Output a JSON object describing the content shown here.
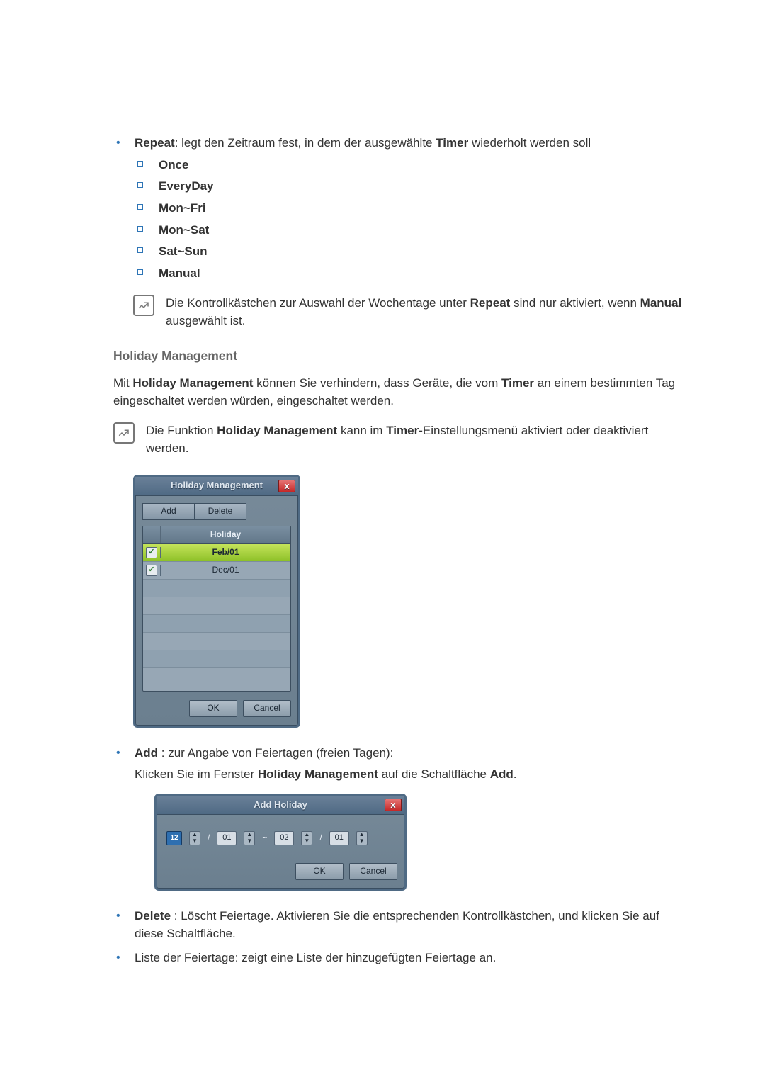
{
  "repeat": {
    "label": "Repeat",
    "desc_1": ": legt den Zeitraum fest, in dem der ausgewählte ",
    "desc_2": " wiederholt werden soll",
    "timer": "Timer",
    "options": {
      "once": "Once",
      "everyday": "EveryDay",
      "monfri": "Mon~Fri",
      "monsat": "Mon~Sat",
      "satsun": "Sat~Sun",
      "manual": "Manual"
    }
  },
  "note1": {
    "t1": "Die Kontrollkästchen zur Auswahl der Wochentage unter ",
    "t2": " sind nur aktiviert, wenn ",
    "t3": " ausgewählt ist.",
    "repeat": "Repeat",
    "manual": "Manual"
  },
  "hm": {
    "heading": "Holiday Management",
    "p1a": "Mit ",
    "p1b": " können Sie verhindern, dass Geräte, die vom ",
    "p1c": " an einem bestimmten Tag eingeschaltet werden würden, eingeschaltet werden.",
    "hm_b": "Holiday Management",
    "timer_b": "Timer"
  },
  "note2": {
    "t1": "Die Funktion ",
    "t2": " kann im ",
    "t3": "-Einstellungsmenü aktiviert oder deaktiviert werden.",
    "hm": "Holiday Management",
    "timer": "Timer"
  },
  "dlg1": {
    "title": "Holiday Management",
    "add": "Add",
    "delete": "Delete",
    "col": "Holiday",
    "rows": {
      "r1": "Feb/01",
      "r2": "Dec/01"
    },
    "ok": "OK",
    "cancel": "Cancel"
  },
  "add": {
    "label": "Add",
    "rest": " : zur Angabe von Feiertagen (freien Tagen):",
    "sub_a": "Klicken Sie im Fenster ",
    "sub_b": " auf die Schaltfläche ",
    "sub_c": ".",
    "hm": "Holiday Management",
    "add_b": "Add"
  },
  "dlg2": {
    "title": "Add Holiday",
    "cal": "12",
    "m1": "01",
    "d1": "01",
    "m2": "02",
    "d2": "01",
    "slash": "/",
    "tilde": "~",
    "ok": "OK",
    "cancel": "Cancel"
  },
  "del": {
    "label": "Delete",
    "rest": " : Löscht Feiertage. Aktivieren Sie die entsprechenden Kontrollkästchen, und klicken Sie auf diese Schaltfläche."
  },
  "list": {
    "text": "Liste der Feiertage: zeigt eine Liste der hinzugefügten Feiertage an."
  }
}
